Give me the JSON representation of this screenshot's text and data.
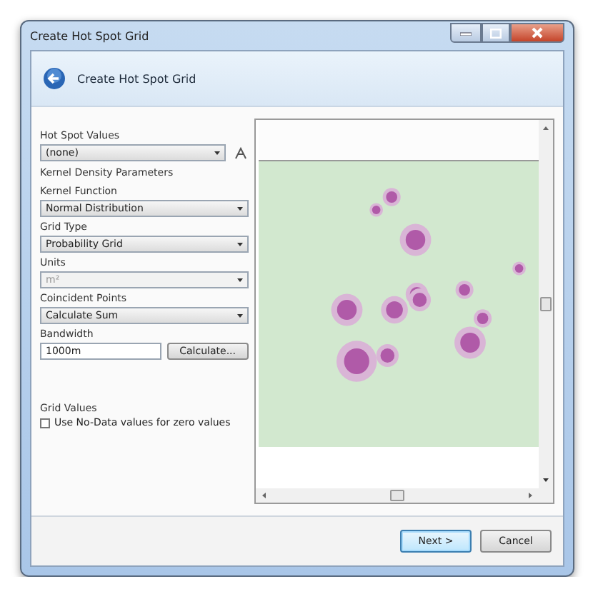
{
  "window": {
    "title": "Create Hot Spot Grid"
  },
  "header": {
    "title": "Create Hot Spot Grid"
  },
  "hot_spot_values": {
    "label": "Hot Spot Values",
    "value": "(none)"
  },
  "section_title": "Kernel Density Parameters",
  "fields": [
    {
      "label": "Kernel Function",
      "value": "Normal Distribution",
      "kind": "combo",
      "disabled": false
    },
    {
      "label": "Grid Type",
      "value": "Probability Grid",
      "kind": "combo",
      "disabled": false
    },
    {
      "label": "Units",
      "value": "m²",
      "kind": "combo",
      "disabled": true
    },
    {
      "label": "Coincident Points",
      "value": "Calculate Sum",
      "kind": "combo",
      "disabled": false
    },
    {
      "label": "Bandwidth",
      "value": "1000m",
      "kind": "text",
      "disabled": false,
      "button": "Calculate..."
    }
  ],
  "grid_values": {
    "title": "Grid Values",
    "checkbox": {
      "label": "Use No-Data values for zero values",
      "checked": false
    }
  },
  "buttons": [
    {
      "label": "Next >",
      "primary": true
    },
    {
      "label": "Cancel",
      "primary": false
    }
  ]
}
